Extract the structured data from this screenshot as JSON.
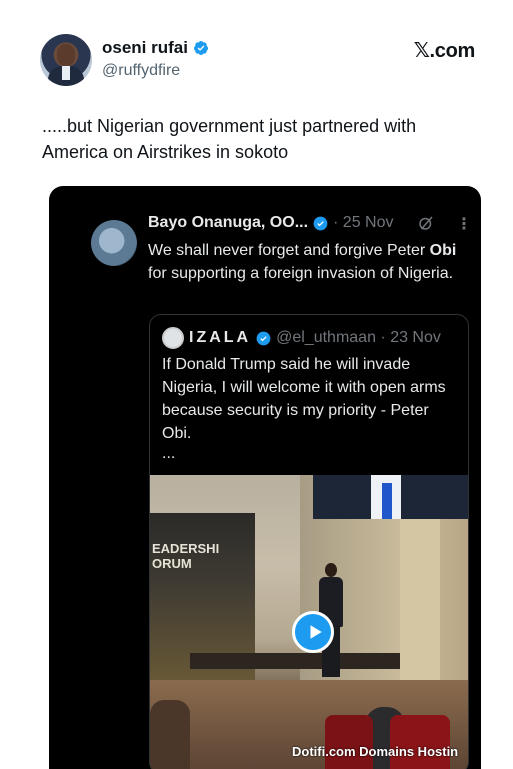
{
  "author": {
    "display_name": "oseni rufai",
    "handle": "@ruffydfire",
    "verified": true
  },
  "brand": {
    "site_label": "𝕏.com"
  },
  "tweet": {
    "text": ".....but Nigerian government just partnered with America on Airstrikes in sokoto"
  },
  "quoted_tweet": {
    "display_name": "Bayo Onanuga, OO...",
    "date": "· 25 Nov",
    "grok_icon": "grok-icon",
    "more_icon": "⋮",
    "text_part1": "We shall never forget and forgive  Peter ",
    "text_bold": "Obi",
    "text_part2": " for supporting a foreign invasion of Nigeria."
  },
  "inner_quote": {
    "display_name": "IZALA",
    "handle_date": "@el_uthmaan · 23 Nov",
    "text": "If Donald Trump said he will invade Nigeria, I will welcome it with open arms because security is my priority - Peter Obi.",
    "ellipsis": "...",
    "video": {
      "banner_text": "EADERSHI\nORUM",
      "play_icon": "play-icon"
    }
  },
  "watermark": "Dotifi.com Domains Hostin",
  "colors": {
    "verified_blue": "#1d9bf0",
    "dark_bg": "#000000",
    "text_primary": "#0f1419",
    "text_secondary": "#536471"
  }
}
